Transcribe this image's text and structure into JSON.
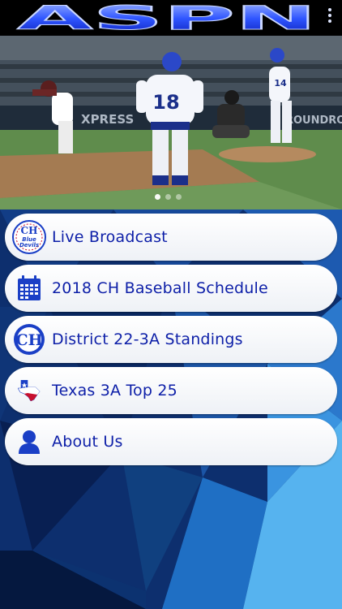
{
  "header": {
    "logo_text": "ASPN",
    "menu_icon": "vertical-dots-icon"
  },
  "hero": {
    "pitcher_number": "18",
    "catcher_number": "14",
    "banner_left": "XPRESS",
    "banner_right": "ROUNDROC",
    "pager": {
      "count": 3,
      "active_index": 0
    }
  },
  "menu": {
    "items": [
      {
        "label": "Live Broadcast",
        "icon": "blue-devils-logo-icon",
        "logo_top": "CH",
        "logo_mid": "Blue",
        "logo_bottom": "Devils"
      },
      {
        "label": "2018 CH Baseball Schedule",
        "icon": "calendar-icon"
      },
      {
        "label": "District 22-3A Standings",
        "icon": "ch-logo-icon",
        "logo_text": "CH"
      },
      {
        "label": "Texas 3A Top 25",
        "icon": "texas-flag-icon"
      },
      {
        "label": "About Us",
        "icon": "person-icon"
      }
    ]
  },
  "colors": {
    "label": "#0d1fa8",
    "accent": "#1a3fc6",
    "header_bg": "#000000"
  }
}
